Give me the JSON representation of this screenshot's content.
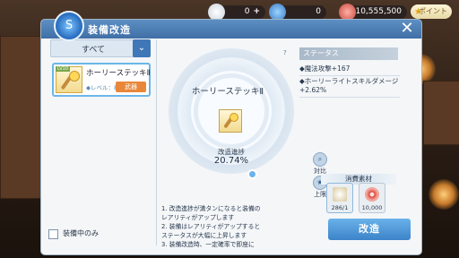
{
  "topbar": {
    "currency1_value": "0",
    "currency1_plus": "+",
    "currency2_value": "0",
    "zeny_value": "10,555,500",
    "point_label": "ポイント"
  },
  "window": {
    "title": "装備改造",
    "close": "✕"
  },
  "left": {
    "filter_label": "すべて",
    "item": {
      "tag": "LV10",
      "name": "ホーリーステッキⅡ",
      "level": "◆レベル：80",
      "badge": "武器"
    },
    "equipped_only_label": "装備中のみ"
  },
  "center": {
    "item_name": "ホーリーステッキⅡ",
    "progress_label": "改造進捗",
    "progress_value": "20.74%",
    "compare_label": "対比",
    "limit_label": "上限",
    "info_lines": [
      "1. 改造進捗が満タンになると装備の",
      "   レアリティがアップします",
      "2. 装備はレアリティがアップすると",
      "   ステータスが大幅に上昇します",
      "3. 装備改造時、一定確率で即座に"
    ]
  },
  "right": {
    "help": "?",
    "status_header": "ステータス",
    "stats": [
      "魔法攻撃+167",
      "ホーリーライトスキルダメージ+2.62%"
    ],
    "materials_title": "消費素材",
    "materials": [
      {
        "name": "scroll-material",
        "count": "286/1"
      },
      {
        "name": "zeny-material",
        "count": "10,000"
      }
    ],
    "upgrade_button": "改造"
  },
  "colors": {
    "title_bar": "#3f6fa6",
    "accent_blue": "#3c83c9",
    "badge_orange": "#e8873a",
    "panel_bg": "#f4f6f8"
  }
}
